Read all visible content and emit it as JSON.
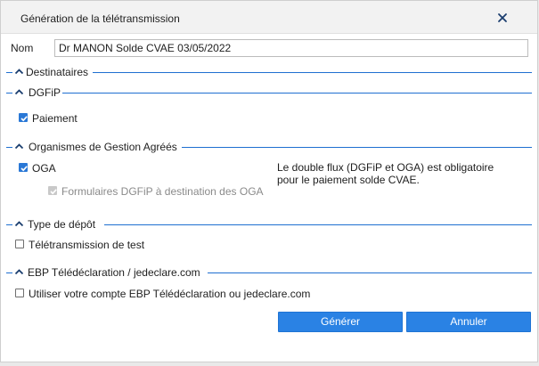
{
  "window": {
    "title": "Génération de la télétransmission",
    "close_icon": "close-icon"
  },
  "name_field": {
    "label": "Nom",
    "value": "Dr MANON Solde CVAE 03/05/2022"
  },
  "sections": {
    "destinataires": {
      "label": "Destinataires",
      "icon": "chevron-up-icon"
    },
    "dgfip": {
      "label": "DGFiP",
      "icon": "chevron-up-icon"
    },
    "oga_section": {
      "label": "Organismes de Gestion Agréés",
      "icon": "chevron-up-icon"
    },
    "type_depot": {
      "label": "Type de dépôt",
      "icon": "chevron-up-icon"
    },
    "ebp": {
      "label": "EBP Télédéclaration / jedeclare.com",
      "icon": "chevron-up-icon"
    }
  },
  "checkboxes": {
    "paiement": {
      "label": "Paiement",
      "checked": true,
      "enabled": true
    },
    "oga": {
      "label": "OGA",
      "checked": true,
      "enabled": true
    },
    "formulaires_dgfip": {
      "label": "Formulaires DGFiP à destination des OGA",
      "checked": true,
      "enabled": false
    },
    "teletransmission_test": {
      "label": "Télétransmission de test",
      "checked": false,
      "enabled": true
    },
    "utiliser_compte": {
      "label": "Utiliser votre compte EBP Télédéclaration ou jedeclare.com",
      "checked": false,
      "enabled": true
    }
  },
  "info": {
    "double_flux": "Le double flux (DGFiP et OGA) est obligatoire\npour le paiement solde CVAE."
  },
  "buttons": {
    "generate_label": "Générer",
    "cancel_label": "Annuler"
  },
  "colors": {
    "accent": "#2a82e4",
    "section_line": "#1e6fd1",
    "disabled_text": "#8a8a8a"
  }
}
